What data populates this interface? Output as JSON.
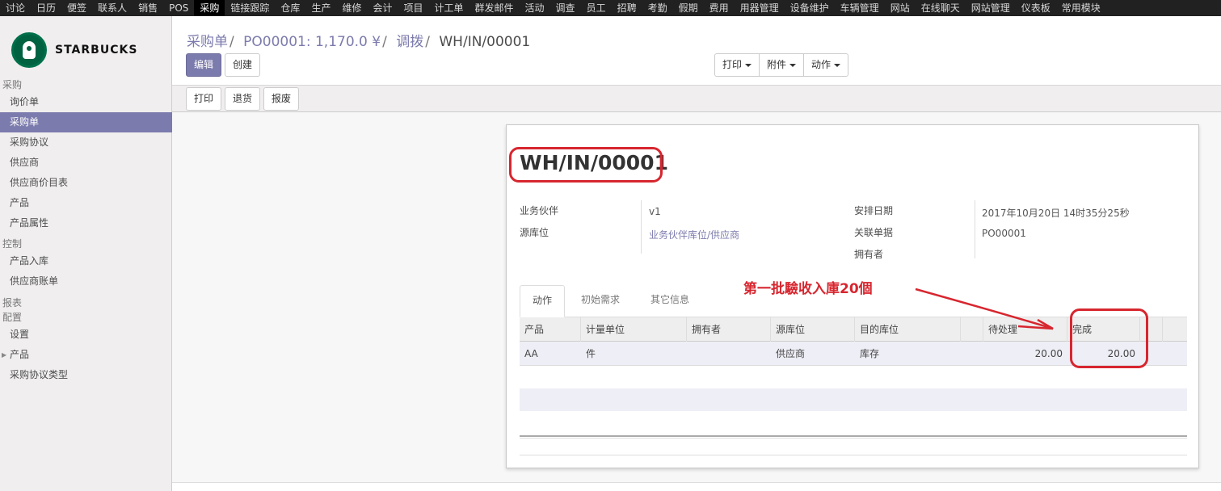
{
  "topbar": {
    "items": [
      "讨论",
      "日历",
      "便签",
      "联系人",
      "销售",
      "POS",
      "采购",
      "链接跟踪",
      "仓库",
      "生产",
      "维修",
      "会计",
      "项目",
      "计工单",
      "群发邮件",
      "活动",
      "调查",
      "员工",
      "招聘",
      "考勤",
      "假期",
      "费用",
      "用器管理",
      "设备维护",
      "车辆管理",
      "网站",
      "在线聊天",
      "网站管理",
      "仪表板",
      "常用模块"
    ],
    "active_index": 6
  },
  "logo": {
    "text": "STARBUCKS"
  },
  "sidebar": {
    "sections": [
      {
        "title": "采购",
        "items": [
          "询价单",
          "采购单",
          "采购协议",
          "供应商",
          "供应商价目表",
          "产品",
          "产品属性"
        ],
        "active_index": 1
      },
      {
        "title": "控制",
        "items": [
          "产品入库",
          "供应商账单"
        ]
      },
      {
        "title": "报表",
        "items": []
      },
      {
        "title": "配置",
        "items": [
          "设置",
          "产品",
          "采购协议类型"
        ]
      }
    ]
  },
  "breadcrumb": {
    "items": [
      "采购单",
      "PO00001: 1,170.0 ¥",
      "调拨"
    ],
    "current": "WH/IN/00001"
  },
  "buttons": {
    "edit": "编辑",
    "create": "创建",
    "print_menu": "打印",
    "attach_menu": "附件",
    "action_menu": "动作"
  },
  "statusbar": {
    "print": "打印",
    "return": "退货",
    "scrap": "报废"
  },
  "record": {
    "name": "WH/IN/00001",
    "labels": {
      "partner": "业务伙伴",
      "source_location": "源库位",
      "scheduled_date": "安排日期",
      "origin": "关联单据",
      "owner": "拥有者"
    },
    "values": {
      "partner": "v1",
      "source_location": "业务伙伴库位/供应商",
      "scheduled_date": "2017年10月20日 14时35分25秒",
      "origin": "PO00001",
      "owner": ""
    }
  },
  "annotation": {
    "text": "第一批驗收入庫20個"
  },
  "tabs": [
    "动作",
    "初始需求",
    "其它信息"
  ],
  "grid": {
    "headers": [
      "产品",
      "计量单位",
      "拥有者",
      "源库位",
      "目的库位",
      "",
      "待处理",
      "完成"
    ],
    "rows": [
      {
        "product": "AA",
        "uom": "件",
        "owner": "",
        "source": "供应商",
        "dest": "库存",
        "pending": "20.00",
        "done": "20.00"
      }
    ]
  }
}
